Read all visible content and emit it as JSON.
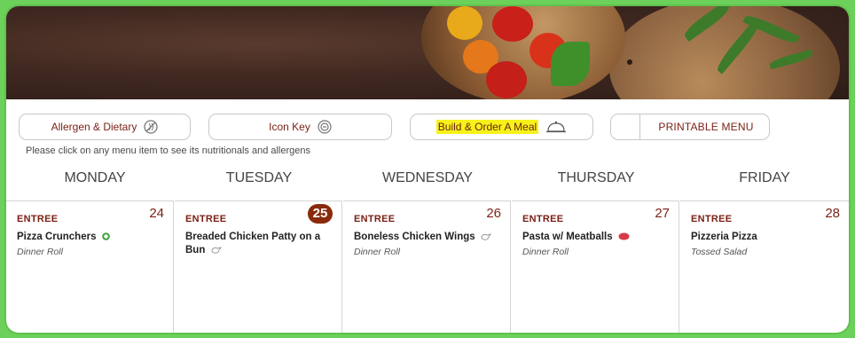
{
  "toolbar": {
    "allergen_label": "Allergen & Dietary",
    "icon_key_label": "Icon Key",
    "build_order_label": "Build & Order A Meal",
    "printable_label": "PRINTABLE MENU"
  },
  "hint": "Please click on any menu item to see its nutritionals and allergens",
  "days": [
    {
      "name": "MONDAY",
      "date": "24",
      "category": "ENTREE",
      "item": "Pizza Crunchers",
      "side": "Dinner Roll",
      "icon": "vegetarian-icon"
    },
    {
      "name": "TUESDAY",
      "date": "25",
      "category": "ENTREE",
      "item": "Breaded Chicken Patty on a Bun",
      "side": "",
      "icon": "chicken-icon"
    },
    {
      "name": "WEDNESDAY",
      "date": "26",
      "category": "ENTREE",
      "item": "Boneless Chicken Wings",
      "side": "Dinner Roll",
      "icon": "chicken-icon"
    },
    {
      "name": "THURSDAY",
      "date": "27",
      "category": "ENTREE",
      "item": "Pasta w/ Meatballs",
      "side": "Dinner Roll",
      "icon": "beef-icon"
    },
    {
      "name": "FRIDAY",
      "date": "28",
      "category": "ENTREE",
      "item": "Pizzeria Pizza",
      "side": "Tossed Salad",
      "icon": ""
    }
  ],
  "colors": {
    "frame": "#6cd15a",
    "accent": "#7a1f14",
    "today_badge": "#8a2a0d",
    "highlight": "#f6f21a"
  }
}
